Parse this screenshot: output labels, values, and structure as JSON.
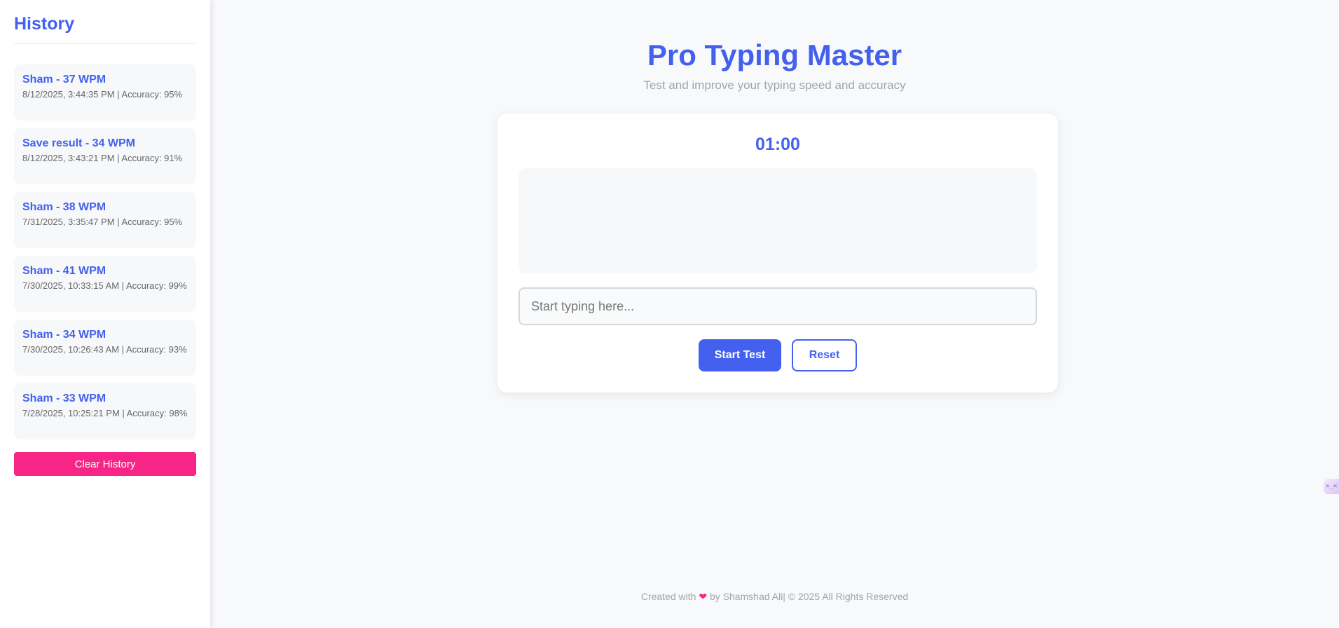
{
  "sidebar": {
    "title": "History",
    "items": [
      {
        "title": "Sham - 37 WPM",
        "detail": "8/12/2025, 3:44:35 PM | Accuracy: 95%"
      },
      {
        "title": "Save result - 34 WPM",
        "detail": "8/12/2025, 3:43:21 PM | Accuracy: 91%"
      },
      {
        "title": "Sham - 38 WPM",
        "detail": "7/31/2025, 3:35:47 PM | Accuracy: 95%"
      },
      {
        "title": "Sham - 41 WPM",
        "detail": "7/30/2025, 10:33:15 AM | Accuracy: 99%"
      },
      {
        "title": "Sham - 34 WPM",
        "detail": "7/30/2025, 10:26:43 AM | Accuracy: 93%"
      },
      {
        "title": "Sham - 33 WPM",
        "detail": "7/28/2025, 10:25:21 PM | Accuracy: 98%"
      }
    ],
    "clear_label": "Clear History"
  },
  "header": {
    "title": "Pro Typing Master",
    "subtitle": "Test and improve your typing speed and accuracy"
  },
  "test": {
    "timer": "01:00",
    "input_placeholder": "Start typing here...",
    "input_value": "",
    "start_label": "Start Test",
    "reset_label": "Reset"
  },
  "footer": {
    "prefix": "Created with",
    "heart": "❤",
    "suffix": "by Shamshad Ali| © 2025 All Rights Reserved"
  },
  "side_tab": {
    "glyph": ">_<"
  },
  "colors": {
    "accent": "#4361ee",
    "danger": "#f72585",
    "background": "#f8f9fb"
  }
}
